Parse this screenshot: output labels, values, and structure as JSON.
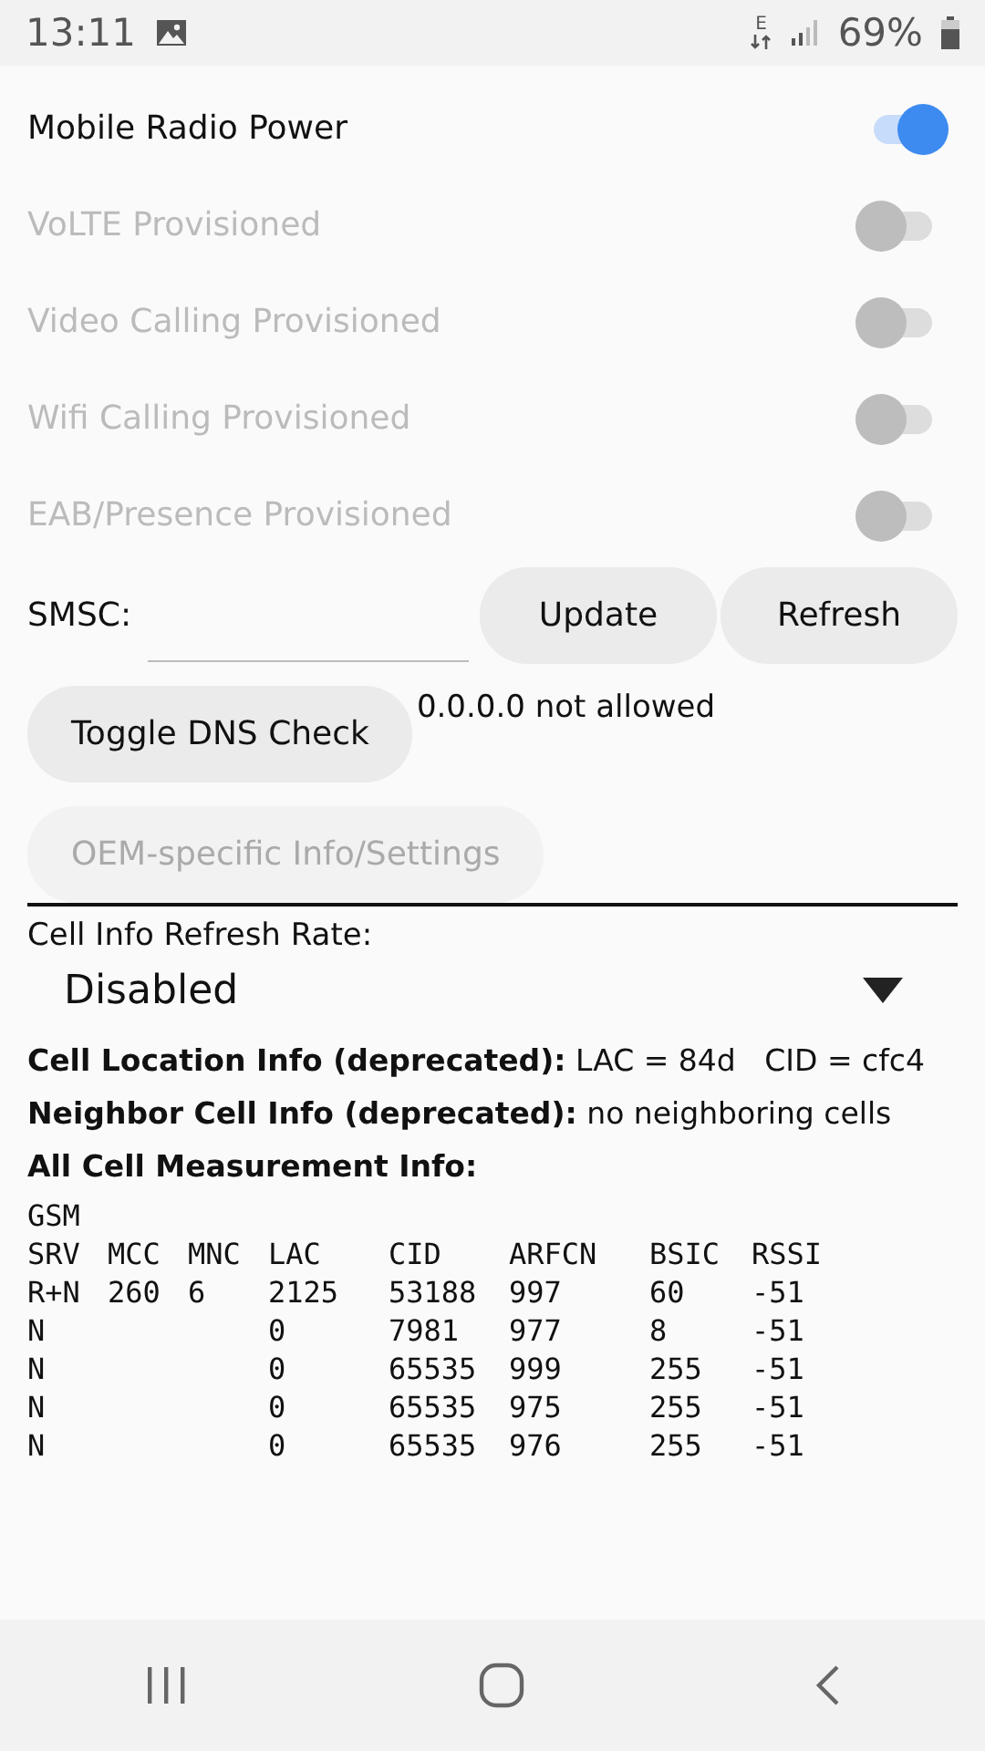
{
  "status_bar": {
    "time": "13:11",
    "network_type": "E",
    "battery": "69%"
  },
  "switches": [
    {
      "label": "Mobile Radio Power",
      "on": true,
      "disabled": false
    },
    {
      "label": "VoLTE Provisioned",
      "on": false,
      "disabled": true
    },
    {
      "label": "Video Calling Provisioned",
      "on": false,
      "disabled": true
    },
    {
      "label": "Wifi Calling Provisioned",
      "on": false,
      "disabled": true
    },
    {
      "label": "EAB/Presence Provisioned",
      "on": false,
      "disabled": true
    }
  ],
  "smsc": {
    "label": "SMSC:",
    "buttons": [
      {
        "label": "Update",
        "disabled": false
      },
      {
        "label": "Refresh",
        "disabled": false
      }
    ]
  },
  "dns": {
    "button": {
      "label": "Toggle DNS Check",
      "disabled": false
    },
    "status": "0.0.0.0 not allowed"
  },
  "oem_button": {
    "label": "OEM-specific Info/Settings",
    "disabled": true
  },
  "refresh_rate": {
    "label": "Cell Info Refresh Rate:",
    "value": "Disabled"
  },
  "info_lines": [
    {
      "label": "Cell Location Info (deprecated):",
      "value": "LAC = 84d   CID = cfc4"
    },
    {
      "label": "Neighbor Cell Info (deprecated):",
      "value": "no neighboring cells"
    },
    {
      "label": "All Cell Measurement Info:"
    }
  ],
  "measurement": {
    "type": "GSM",
    "columns": [
      "SRV",
      "MCC",
      "MNC",
      "LAC",
      "CID",
      "ARFCN",
      "BSIC",
      "RSSI"
    ],
    "rows": [
      [
        "R+N",
        "260",
        "6",
        "2125",
        "53188",
        "997",
        "60",
        "-51"
      ],
      [
        "N",
        "",
        "",
        "0",
        "7981",
        "977",
        "8",
        "-51"
      ],
      [
        "N",
        "",
        "",
        "0",
        "65535",
        "999",
        "255",
        "-51"
      ],
      [
        "N",
        "",
        "",
        "0",
        "65535",
        "975",
        "255",
        "-51"
      ],
      [
        "N",
        "",
        "",
        "0",
        "65535",
        "976",
        "255",
        "-51"
      ]
    ]
  }
}
